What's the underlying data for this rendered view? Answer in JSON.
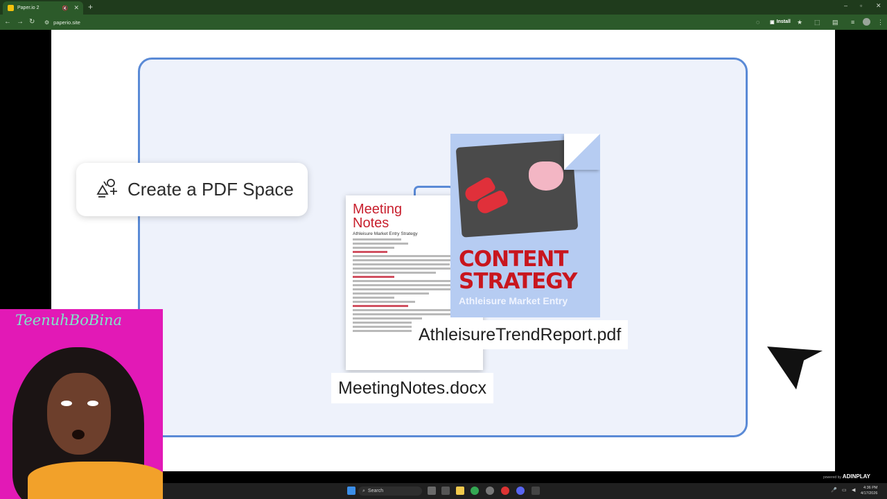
{
  "browser": {
    "tab_title": "Paper.io 2",
    "url": "paperio.site",
    "install_label": "Install"
  },
  "page": {
    "create_space_label": "Create a PDF Space",
    "meeting_doc": {
      "title": "Meeting Notes",
      "subtitle": "Athleisure Market Entry Strategy"
    },
    "content_doc": {
      "title": "CONTENT STRATEGY",
      "subtitle": "Athleisure Market Entry"
    },
    "file_pdf_name": "AthleisureTrendReport.pdf",
    "file_docx_name": "MeetingNotes.docx"
  },
  "webcam": {
    "signature": "TeenuhBoBina"
  },
  "taskbar": {
    "search_placeholder": "Search",
    "ad_powered": "powered by",
    "ad_brand": "ADINPLAY",
    "time": "4:36 PM",
    "date": "4/17/2026"
  },
  "colors": {
    "accent_blue": "#5a8ad6",
    "brand_red": "#c8161e",
    "chrome_green": "#2c5a2a",
    "webcam_magenta": "#e219b6"
  }
}
